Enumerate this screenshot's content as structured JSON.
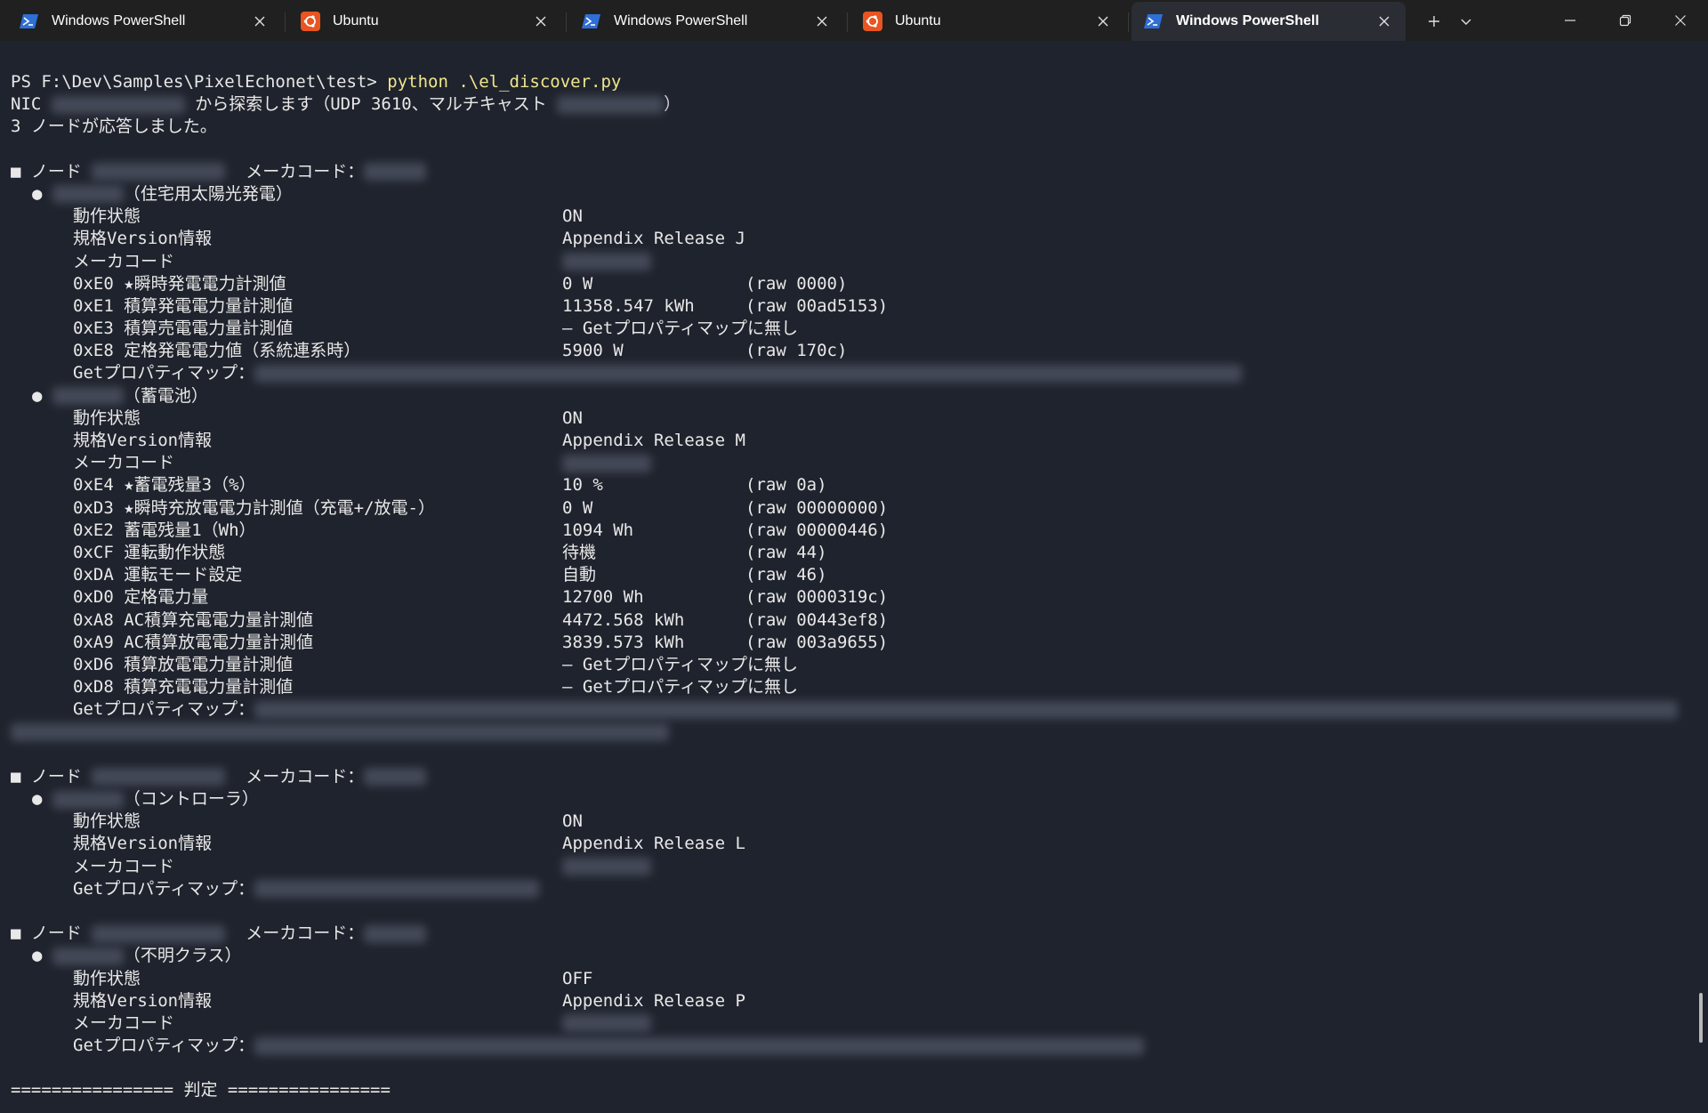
{
  "tabs": [
    {
      "label": "Windows PowerShell",
      "icon": "powershell-icon",
      "active": false
    },
    {
      "label": "Ubuntu",
      "icon": "ubuntu-icon",
      "active": false
    },
    {
      "label": "Windows PowerShell",
      "icon": "powershell-icon",
      "active": false
    },
    {
      "label": "Ubuntu",
      "icon": "ubuntu-icon",
      "active": false
    },
    {
      "label": "Windows PowerShell",
      "icon": "powershell-icon",
      "active": true
    }
  ],
  "tab_actions": {
    "new_tab": "+",
    "dropdown": "⌄"
  },
  "colors": {
    "background": "#1f232d",
    "tabbar": "#202020",
    "active_tab": "#2b2d35",
    "command": "#f0e68c",
    "text": "#e8e8e8",
    "powershell": "#2f6fd6",
    "ubuntu": "#e95420"
  },
  "terminal": {
    "prompt": "PS F:\\Dev\\Samples\\PixelEchonet\\test> ",
    "command": "python .\\el_discover.py",
    "nic_prefix": "NIC ",
    "nic_mid": " から探索します（UDP 3610、マルチキャスト ",
    "nic_end": "）",
    "responded": "3 ノードが応答しました。",
    "node_prefix": "■ ノード ",
    "maker_label": "メーカコード：",
    "bullet": "● ",
    "nodes": [
      {
        "objects": [
          {
            "class": "（住宅用太陽光発電）",
            "props": [
              {
                "name": "動作状態",
                "value": "ON",
                "raw": ""
              },
              {
                "name": "規格Version情報",
                "value": "Appendix Release J",
                "raw": ""
              },
              {
                "name": "メーカコード",
                "value": "",
                "raw": ""
              },
              {
                "name": "0xE0 ★瞬時発電電力計測値",
                "value": "0 W",
                "raw": "(raw 0000)"
              },
              {
                "name": "0xE1 積算発電電力量計測値",
                "value": "11358.547 kWh",
                "raw": "(raw 00ad5153)"
              },
              {
                "name": "0xE3 積算売電電力量計測値",
                "value": "– Getプロパティマップに無し",
                "raw": ""
              },
              {
                "name": "0xE8 定格発電電力値（系統連系時）",
                "value": "5900 W",
                "raw": "(raw 170c)"
              }
            ],
            "getmap": "Getプロパティマップ："
          },
          {
            "class": "（蓄電池）",
            "props": [
              {
                "name": "動作状態",
                "value": "ON",
                "raw": ""
              },
              {
                "name": "規格Version情報",
                "value": "Appendix Release M",
                "raw": ""
              },
              {
                "name": "メーカコード",
                "value": "",
                "raw": ""
              },
              {
                "name": "0xE4 ★蓄電残量3（%）",
                "value": "10 %",
                "raw": "(raw 0a)"
              },
              {
                "name": "0xD3 ★瞬時充放電電力計測値（充電+/放電-）",
                "value": "0 W",
                "raw": "(raw 00000000)"
              },
              {
                "name": "0xE2 蓄電残量1（Wh）",
                "value": "1094 Wh",
                "raw": "(raw 00000446)"
              },
              {
                "name": "0xCF 運転動作状態",
                "value": "待機",
                "raw": "(raw 44)"
              },
              {
                "name": "0xDA 運転モード設定",
                "value": "自動",
                "raw": "(raw 46)"
              },
              {
                "name": "0xD0 定格電力量",
                "value": "12700 Wh",
                "raw": "(raw 0000319c)"
              },
              {
                "name": "0xA8 AC積算充電電力量計測値",
                "value": "4472.568 kWh",
                "raw": "(raw 00443ef8)"
              },
              {
                "name": "0xA9 AC積算放電電力量計測値",
                "value": "3839.573 kWh",
                "raw": "(raw 003a9655)"
              },
              {
                "name": "0xD6 積算放電電力量計測値",
                "value": "– Getプロパティマップに無し",
                "raw": ""
              },
              {
                "name": "0xD8 積算充電電力量計測値",
                "value": "– Getプロパティマップに無し",
                "raw": ""
              }
            ],
            "getmap": "Getプロパティマップ："
          }
        ]
      },
      {
        "objects": [
          {
            "class": "（コントローラ）",
            "props": [
              {
                "name": "動作状態",
                "value": "ON",
                "raw": ""
              },
              {
                "name": "規格Version情報",
                "value": "Appendix Release L",
                "raw": ""
              },
              {
                "name": "メーカコード",
                "value": "",
                "raw": ""
              }
            ],
            "getmap": "Getプロパティマップ："
          }
        ]
      },
      {
        "objects": [
          {
            "class": "（不明クラス）",
            "props": [
              {
                "name": "動作状態",
                "value": "OFF",
                "raw": ""
              },
              {
                "name": "規格Version情報",
                "value": "Appendix Release P",
                "raw": ""
              },
              {
                "name": "メーカコード",
                "value": "",
                "raw": ""
              }
            ],
            "getmap": "Getプロパティマップ："
          }
        ]
      }
    ],
    "verdict_header": "================ 判定 ================"
  }
}
